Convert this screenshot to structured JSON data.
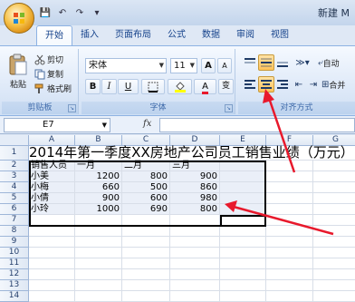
{
  "titlebar": {
    "title": "新建 M"
  },
  "qat": {
    "save": "💾",
    "undo": "↶",
    "redo": "↷",
    "more": "▾"
  },
  "tabs": [
    "开始",
    "插入",
    "页面布局",
    "公式",
    "数据",
    "审阅",
    "视图"
  ],
  "ribbon": {
    "clipboard": {
      "paste": "粘贴",
      "cut": "剪切",
      "copy": "复制",
      "format_painter": "格式刷",
      "label": "剪贴板"
    },
    "font": {
      "name": "宋体",
      "size": "11",
      "grow": "A",
      "shrink": "A",
      "bold": "B",
      "italic": "I",
      "underline": "U",
      "wen": "变",
      "label": "字体"
    },
    "alignment": {
      "wrap": "自动",
      "merge": "合并",
      "label": "对齐方式"
    }
  },
  "formula_bar": {
    "name_box": "E7",
    "fx": "fx"
  },
  "columns": [
    "A",
    "B",
    "C",
    "D",
    "E",
    "F",
    "G"
  ],
  "rows": [
    "1",
    "2",
    "3",
    "4",
    "5",
    "6",
    "7",
    "8",
    "9",
    "10",
    "11",
    "12",
    "13",
    "14"
  ],
  "sheet": {
    "title": "2014年第一季度XX房地产公司员工销售业绩（万元）",
    "headers": [
      "销售人员",
      "一月",
      "二月",
      "三月"
    ],
    "data": [
      [
        "小美",
        "1200",
        "800",
        "900"
      ],
      [
        "小梅",
        "660",
        "500",
        "860"
      ],
      [
        "小倩",
        "900",
        "600",
        "980"
      ],
      [
        "小玲",
        "1000",
        "690",
        "800"
      ]
    ]
  },
  "colors": {
    "arrow": "#e8192c",
    "highlight": "#ffc35a"
  }
}
